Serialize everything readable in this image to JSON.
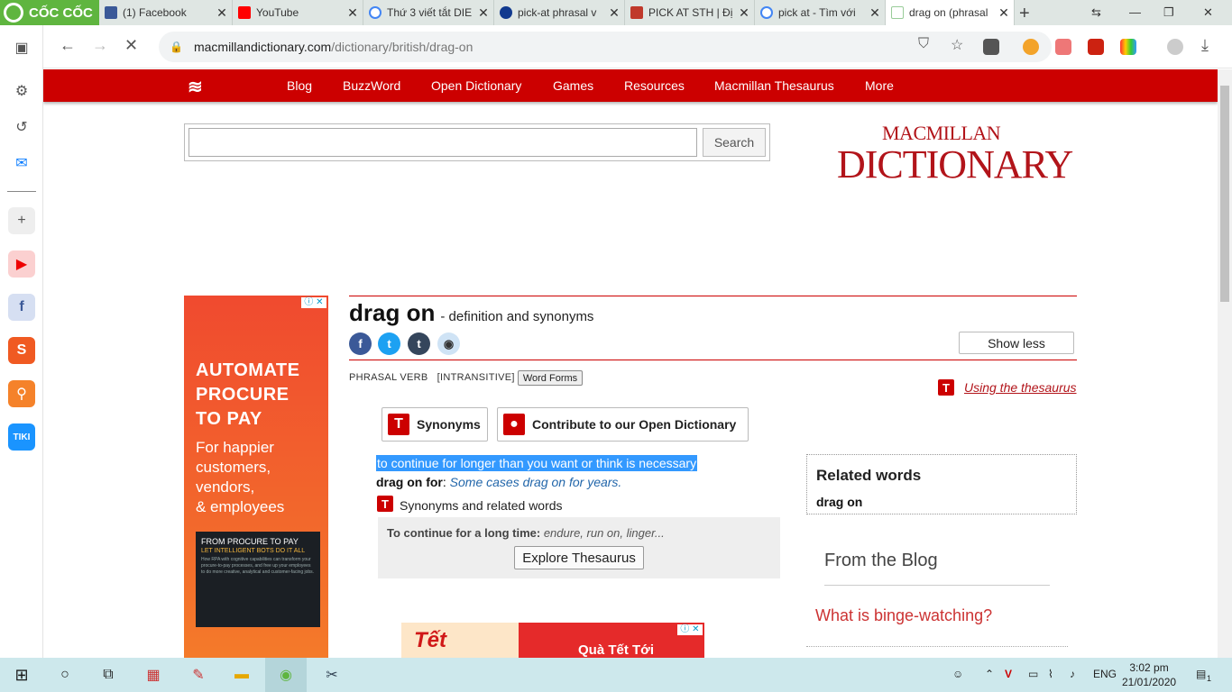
{
  "browser": {
    "brand": "CỐC CỐC",
    "tabs": [
      {
        "title": "(1) Facebook"
      },
      {
        "title": "YouTube"
      },
      {
        "title": "Thứ 3 viết tắt DIE"
      },
      {
        "title": "pick-at phrasal v"
      },
      {
        "title": "PICK AT STH | Đị"
      },
      {
        "title": "pick at - Tìm với"
      },
      {
        "title": "drag on (phrasal"
      }
    ],
    "url_domain": "macmillandictionary.com",
    "url_path": "/dictionary/british/drag-on"
  },
  "site": {
    "nav": [
      "Blog",
      "BuzzWord",
      "Open Dictionary",
      "Games",
      "Resources",
      "Macmillan Thesaurus",
      "More"
    ],
    "search_button": "Search",
    "search_value": "",
    "logo_line1": "MACMILLAN",
    "logo_line2": "DICTIONARY"
  },
  "ad_left": {
    "headline": [
      "AUTOMATE",
      "PROCURE",
      "TO PAY"
    ],
    "sub": [
      "For happier",
      "customers,",
      "vendors,",
      "& employees"
    ],
    "box_title": "FROM PROCURE TO PAY",
    "box_tag": "LET INTELLIGENT BOTS DO IT ALL",
    "box_body": "How RPA with cognitive capabilities can transform your procure-to-pay processes, and free up your employees to do more creative, analytical and customer-facing jobs.",
    "close_glyph": "ⓘ ✕"
  },
  "entry": {
    "headword": "drag on",
    "subtitle": "- definition and synonyms",
    "show_less": "Show less",
    "pos": "PHRASAL VERB",
    "grammar": "[INTRANSITIVE]",
    "word_forms": "Word Forms",
    "thesaurus_link": "Using the thesaurus",
    "btn_synonyms": "Synonyms",
    "btn_contribute": "Contribute to our Open Dictionary",
    "definition": "to continue for longer than you want or think is necessary",
    "example_term": "drag on for",
    "example_text": "Some cases drag on for years.",
    "synonyms_label": "Synonyms and related words",
    "thes_lead": "To continue for a long time:",
    "thes_words": "endure, run on, linger...",
    "explore_btn": "Explore Thesaurus"
  },
  "sidebar_right": {
    "related_title": "Related words",
    "related_item": "drag on",
    "blog_title": "From the Blog",
    "blog_link": "What is binge-watching?"
  },
  "ad_bottom": {
    "left_text": "Tết",
    "right_text": "Quà Tết Tới",
    "close_glyph": "ⓘ ✕"
  },
  "taskbar": {
    "lang": "ENG",
    "time": "3:02 pm",
    "date": "21/01/2020",
    "notif_count": "1"
  },
  "colors": {
    "brand_red": "#cc0000",
    "coccoc_green": "#5fb53f",
    "selection_blue": "#3399ff"
  }
}
